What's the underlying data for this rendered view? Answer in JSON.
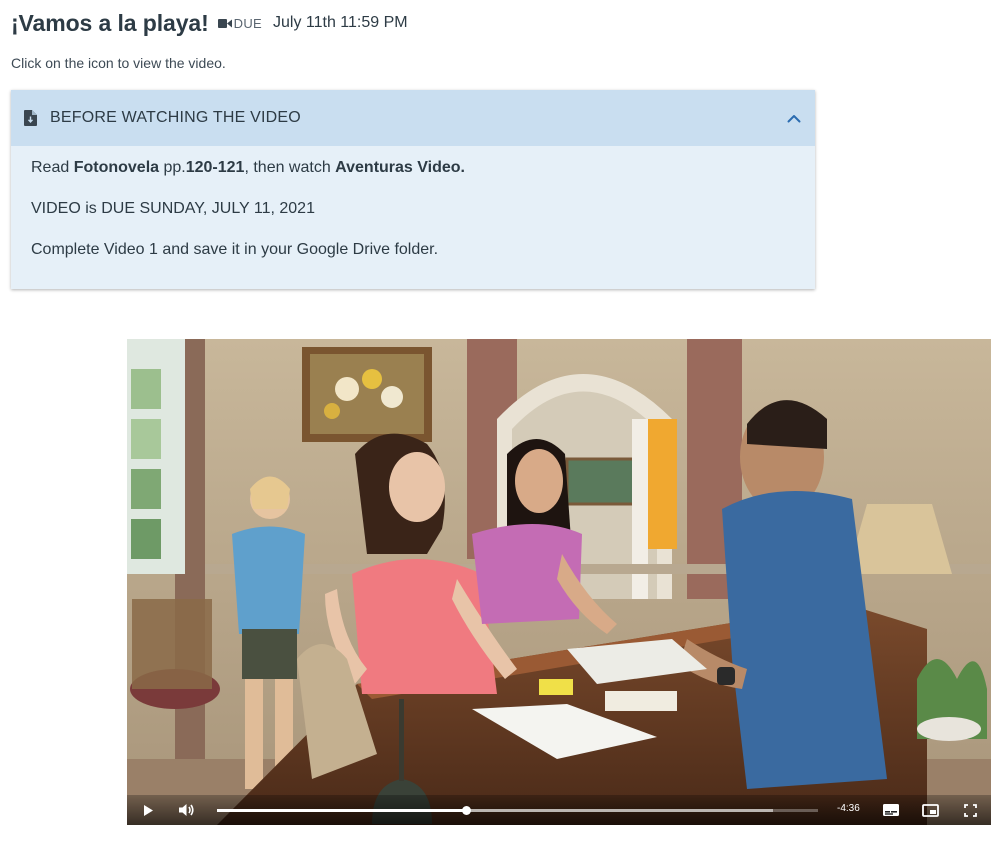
{
  "assignment": {
    "title": "¡Vamos a la playa!",
    "type_icon": "video-camera-icon",
    "due_label": "DUE",
    "due_date": "July 11th 11:59 PM"
  },
  "instruction": "Click on the icon to view the video.",
  "panel": {
    "icon": "document-icon",
    "title": "BEFORE WATCHING THE VIDEO",
    "expanded": true,
    "line1": {
      "read": "Read ",
      "book": "Fotonovela",
      "pp": " pp.",
      "pages": "120-121",
      "then": ", then watch ",
      "video": "Aventuras Video."
    },
    "line2": "VIDEO is DUE SUNDAY, JULY 11, 2021",
    "line3": "Complete Video 1 and save it in your Google Drive folder."
  },
  "video": {
    "time_remaining": "-4:36",
    "progress_fraction": 0.415,
    "buffered_fraction": 0.925,
    "controls": [
      "play-icon",
      "volume-icon",
      "captions-icon",
      "picture-in-picture-icon",
      "fullscreen-icon"
    ]
  },
  "colors": {
    "panel_header": "#c9def0",
    "panel_body": "#e6f0f8",
    "text": "#2d3b45"
  }
}
